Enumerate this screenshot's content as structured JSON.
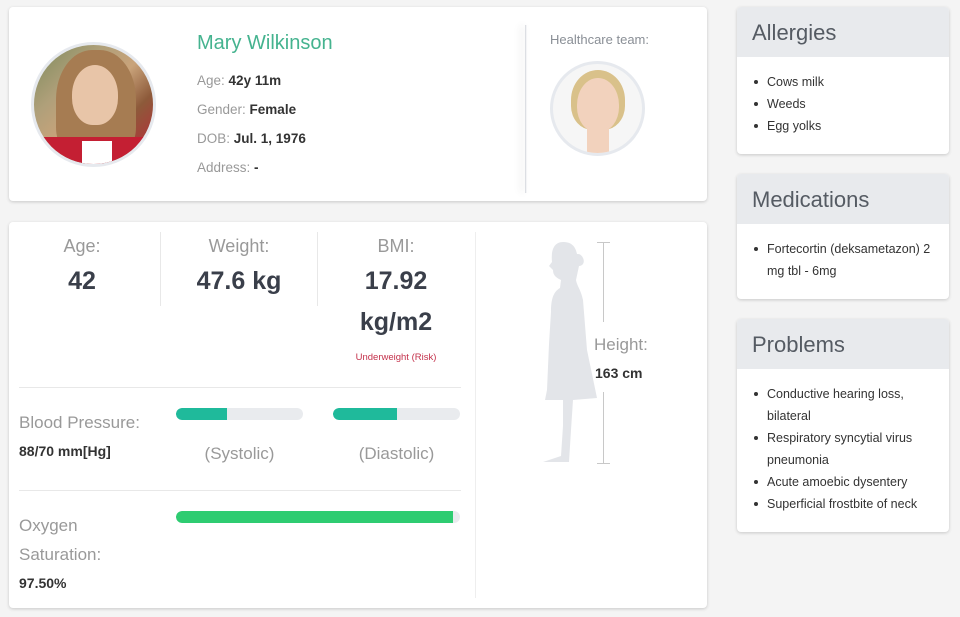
{
  "patient": {
    "name": "Mary Wilkinson",
    "age_label": "Age:",
    "age_value": "42y 11m",
    "gender_label": "Gender:",
    "gender_value": "Female",
    "dob_label": "DOB:",
    "dob_value": "Jul. 1, 1976",
    "address_label": "Address:",
    "address_value": "-"
  },
  "team": {
    "label": "Healthcare team:"
  },
  "vitals": {
    "age": {
      "label": "Age:",
      "value": "42"
    },
    "weight": {
      "label": "Weight:",
      "value": "47.6 kg"
    },
    "bmi": {
      "label": "BMI:",
      "value": "17.92",
      "unit": "kg/m2",
      "status": "Underweight (Risk)",
      "status_color": "#c4314b"
    },
    "blood_pressure": {
      "label": "Blood Pressure:",
      "value": "88/70 mm[Hg]",
      "systolic_label": "(Systolic)",
      "diastolic_label": "(Diastolic)",
      "systolic_fill_percent": 40,
      "diastolic_fill_percent": 50,
      "bar_color": "#1fba9b"
    },
    "oxygen": {
      "label_line1": "Oxygen",
      "label_line2": "Saturation:",
      "value": "97.50%",
      "fill_percent": 97.5,
      "bar_color": "#2ecc71"
    },
    "height": {
      "label": "Height:",
      "value": "163 cm"
    }
  },
  "allergies": {
    "title": "Allergies",
    "items": [
      "Cows milk",
      "Weeds",
      "Egg yolks"
    ]
  },
  "medications": {
    "title": "Medications",
    "items": [
      "Fortecortin (deksametazon) 2 mg tbl - 6mg"
    ]
  },
  "problems": {
    "title": "Problems",
    "items": [
      "Conductive hearing loss, bilateral",
      "Respiratory syncytial virus pneumonia",
      "Acute amoebic dysentery",
      "Superficial frostbite of neck"
    ]
  },
  "colors": {
    "accent_name": "#45b38f"
  }
}
